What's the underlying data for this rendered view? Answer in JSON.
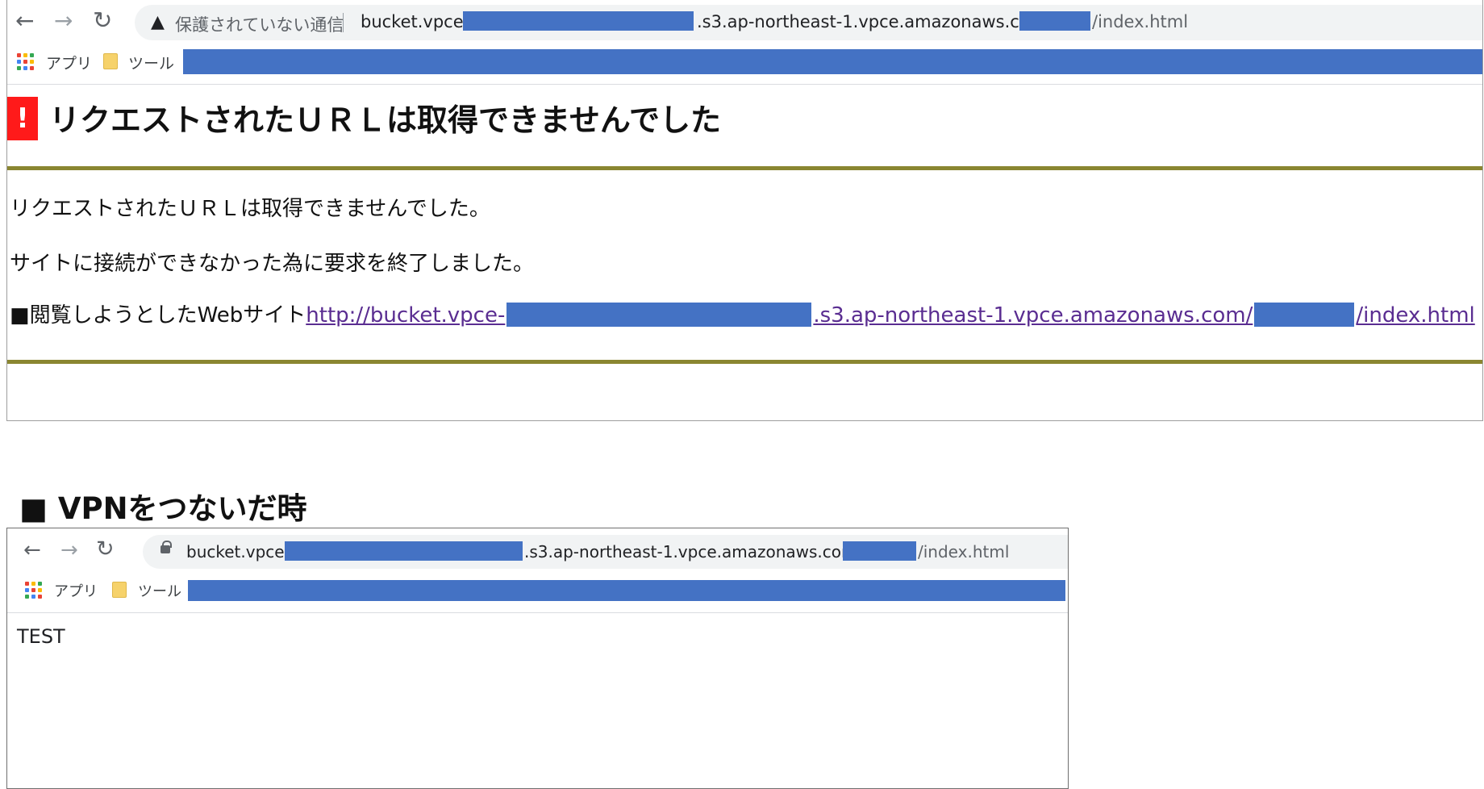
{
  "browser1": {
    "security_label": "保護されていない通信",
    "url_prefix": "bucket.vpce-",
    "url_middle": ".s3.ap-northeast-1.vpce.amazonaws.com/",
    "url_suffix": "/index.html",
    "bookmarks": {
      "apps": "アプリ",
      "tools": "ツール"
    }
  },
  "error_page": {
    "badge": "!",
    "title": "リクエストされたＵＲＬは取得できませんでした",
    "line1": "リクエストされたＵＲＬは取得できませんでした。",
    "line2": "サイトに接続ができなかった為に要求を終了しました。",
    "line3_label": "■閲覧しようとしたWebサイト",
    "link_prefix": "http://bucket.vpce-",
    "link_middle": ".s3.ap-northeast-1.vpce.amazonaws.com/",
    "link_suffix": "/index.html"
  },
  "section_heading": "■ VPNをつないだ時",
  "browser2": {
    "url_prefix": "bucket.vpce-",
    "url_middle": ".s3.ap-northeast-1.vpce.amazonaws.com/",
    "url_suffix": "/index.html",
    "bookmarks": {
      "apps": "アプリ",
      "tools": "ツール"
    }
  },
  "page2": {
    "content": "TEST"
  },
  "colors": {
    "redaction": "#4472c4",
    "error_red": "#ff1a1a",
    "rule_olive": "#8a8631",
    "link_visited": "#5a2d91"
  },
  "icons": [
    "back-arrow-icon",
    "forward-arrow-icon",
    "reload-icon",
    "warning-icon",
    "lock-icon",
    "apps-grid-icon",
    "folder-icon"
  ]
}
